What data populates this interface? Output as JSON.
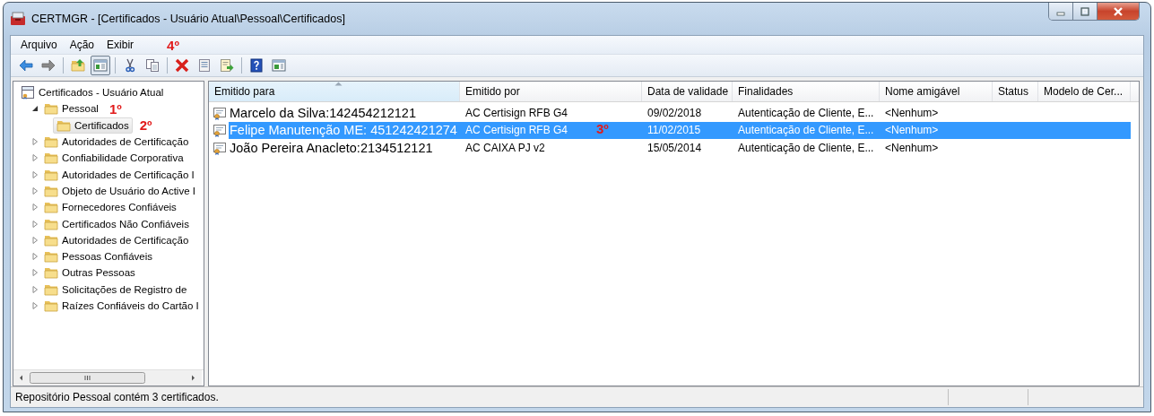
{
  "window": {
    "title": "CERTMGR - [Certificados - Usuário Atual\\Pessoal\\Certificados]"
  },
  "menu": {
    "items": [
      "Arquivo",
      "Ação",
      "Exibir"
    ],
    "annotation": "4º"
  },
  "toolbar": {
    "groups": [
      [
        {
          "kind": "back",
          "pressed": false
        },
        {
          "kind": "forward",
          "pressed": false
        }
      ],
      [
        {
          "kind": "up",
          "pressed": false
        },
        {
          "kind": "console-tree",
          "pressed": true
        }
      ],
      [
        {
          "kind": "cut",
          "pressed": false
        },
        {
          "kind": "copy",
          "pressed": false
        }
      ],
      [
        {
          "kind": "delete",
          "pressed": false
        },
        {
          "kind": "properties",
          "pressed": false
        },
        {
          "kind": "export",
          "pressed": false
        }
      ],
      [
        {
          "kind": "help",
          "pressed": false
        },
        {
          "kind": "action-pane",
          "pressed": false
        }
      ]
    ]
  },
  "tree": {
    "root": {
      "label": "Certificados - Usuário Atual",
      "selected": false,
      "children": [
        {
          "label": "Pessoal",
          "expanded": true,
          "selected": false,
          "annotation": "1º",
          "children": [
            {
              "label": "Certificados",
              "selected": true,
              "annotation": "2º"
            }
          ]
        },
        {
          "label": "Autoridades de Certificação",
          "expanded": false,
          "selected": false
        },
        {
          "label": "Confiabilidade Corporativa",
          "expanded": false,
          "selected": false
        },
        {
          "label": "Autoridades de Certificação I",
          "expanded": false,
          "selected": false
        },
        {
          "label": "Objeto de Usuário do Active I",
          "expanded": false,
          "selected": false
        },
        {
          "label": "Fornecedores Confiáveis",
          "expanded": false,
          "selected": false
        },
        {
          "label": "Certificados Não Confiáveis",
          "expanded": false,
          "selected": false
        },
        {
          "label": "Autoridades de Certificação",
          "expanded": false,
          "selected": false
        },
        {
          "label": "Pessoas Confiáveis",
          "expanded": false,
          "selected": false
        },
        {
          "label": "Outras Pessoas",
          "expanded": false,
          "selected": false
        },
        {
          "label": "Solicitações de Registro de",
          "expanded": false,
          "selected": false
        },
        {
          "label": "Raízes Confiáveis do Cartão I",
          "expanded": false,
          "selected": false
        }
      ]
    }
  },
  "list": {
    "columns": [
      {
        "label": "Emitido para",
        "sorted": true
      },
      {
        "label": "Emitido por",
        "sorted": false
      },
      {
        "label": "Data de validade",
        "sorted": false
      },
      {
        "label": "Finalidades",
        "sorted": false
      },
      {
        "label": "Nome amigável",
        "sorted": false
      },
      {
        "label": "Status",
        "sorted": false
      },
      {
        "label": "Modelo de Cer...",
        "sorted": false
      }
    ],
    "rows": [
      {
        "selected": false,
        "cells": [
          "Marcelo da Silva:142454212121",
          "AC Certisign RFB G4",
          "09/02/2018",
          "Autenticação de Cliente, E...",
          "<Nenhum>"
        ]
      },
      {
        "selected": true,
        "annotation": "3º",
        "cells": [
          "Felipe Manutenção ME: 451242421274",
          "AC Certisign RFB G4",
          "11/02/2015",
          "Autenticação de Cliente, E...",
          "<Nenhum>"
        ]
      },
      {
        "selected": false,
        "cells": [
          "João Pereira Anacleto:2134512121",
          "AC CAIXA PJ v2",
          "15/05/2014",
          "Autenticação de Cliente, E...",
          "<Nenhum>"
        ]
      }
    ]
  },
  "status_bar": {
    "text": "Repositório Pessoal contém 3 certificados."
  }
}
